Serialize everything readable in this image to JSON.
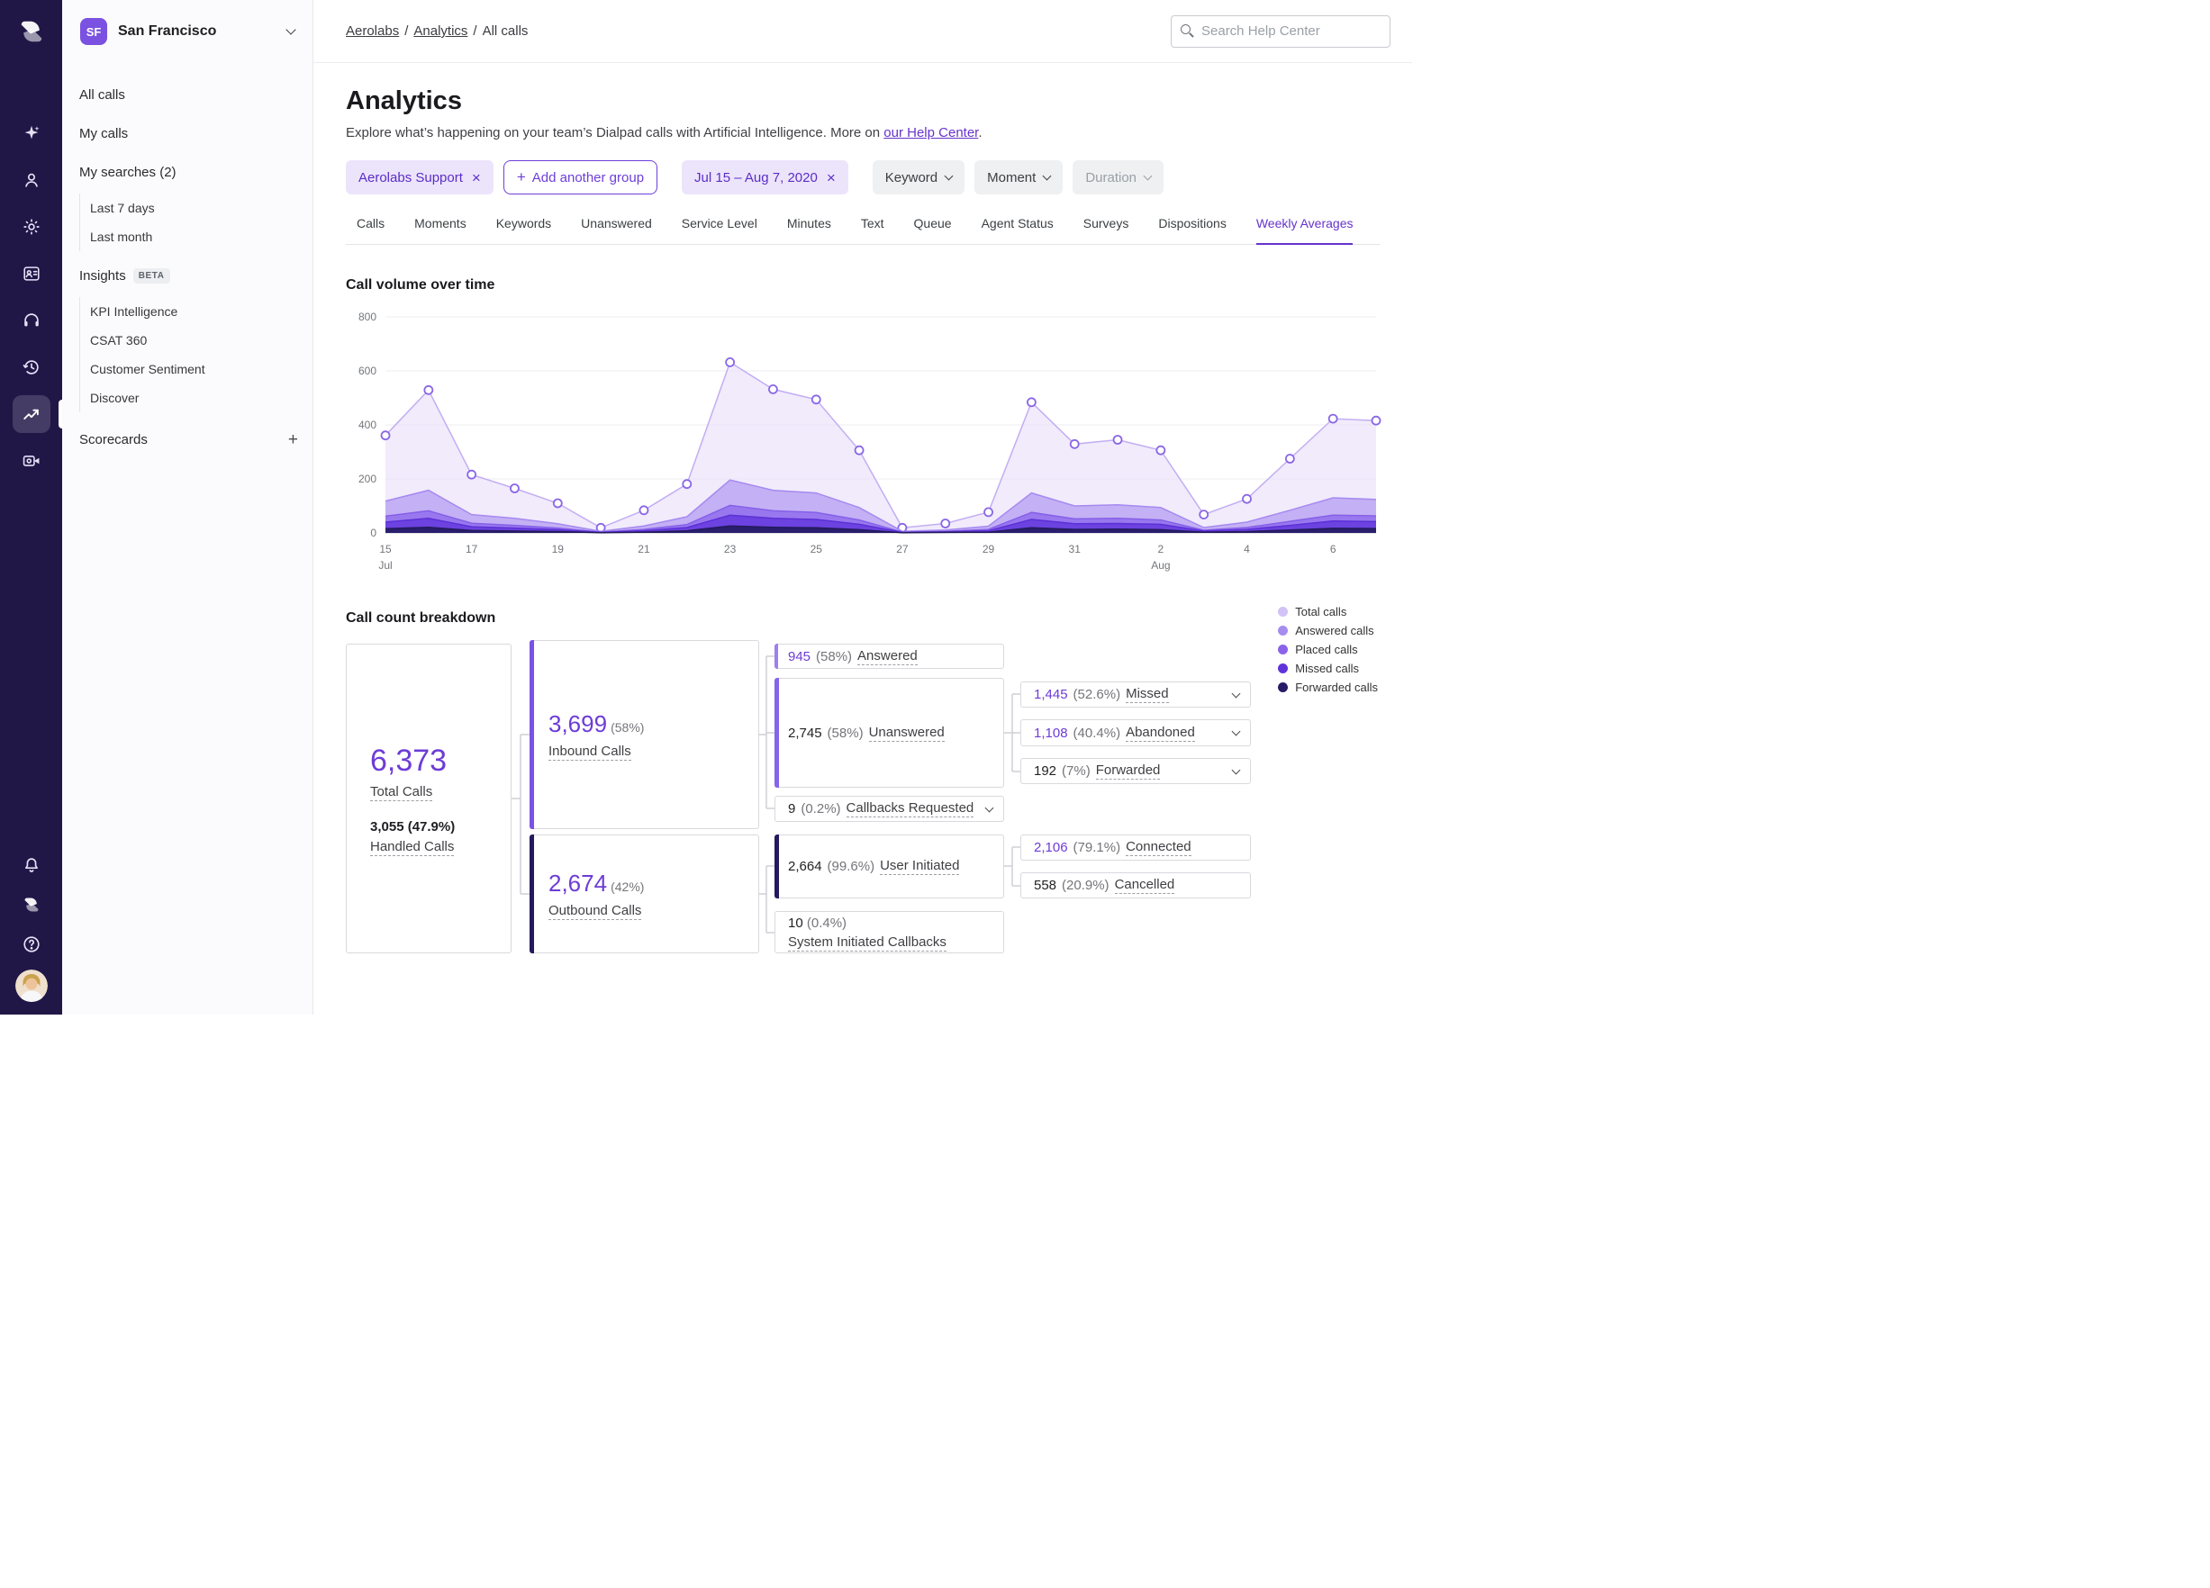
{
  "colors": {
    "accent": "#6633cc",
    "rail_bg": "#211747",
    "chip_purple_bg": "#ece4fb",
    "chip_purple_text": "#5b2ec7",
    "number_purple": "#6d3cd6"
  },
  "rail": {
    "top_icons": [
      "dialpad-logo",
      "ai-sparkle-icon",
      "person-icon",
      "gear-icon",
      "contacts-icon",
      "headset-icon",
      "history-icon",
      "analytics-trend-icon",
      "video-settings-icon"
    ],
    "bottom_icons": [
      "bell-icon",
      "dialpad-mark-icon",
      "help-icon",
      "user-avatar"
    ],
    "active_icon": "analytics-trend-icon"
  },
  "sidebar": {
    "workspace_initials": "SF",
    "workspace_name": "San Francisco",
    "all_calls": "All calls",
    "my_calls": "My calls",
    "my_searches": "My searches (2)",
    "searches": [
      "Last 7 days",
      "Last month"
    ],
    "insights": "Insights",
    "beta_badge": "BETA",
    "insights_items": [
      "KPI Intelligence",
      "CSAT 360",
      "Customer Sentiment",
      "Discover"
    ],
    "scorecards": "Scorecards",
    "add_scorecard": "+"
  },
  "topbar": {
    "breadcrumb": [
      "Aerolabs",
      "Analytics",
      "All calls"
    ],
    "separator": "/",
    "search_placeholder": "Search Help Center"
  },
  "page": {
    "title": "Analytics",
    "subtitle_pre": "Explore what’s happening on your team’s Dialpad calls with Artificial Intelligence. More on ",
    "subtitle_link": "our Help Center",
    "subtitle_post": "."
  },
  "filters": {
    "group": "Aerolabs Support",
    "remove": "×",
    "add_plus": "+",
    "add_group": "Add another group",
    "date_range": "Jul 15 – Aug 7, 2020",
    "keyword": "Keyword",
    "moment": "Moment",
    "duration": "Duration"
  },
  "tabs": {
    "items": [
      "Calls",
      "Moments",
      "Keywords",
      "Unanswered",
      "Service Level",
      "Minutes",
      "Text",
      "Queue",
      "Agent Status",
      "Surveys",
      "Dispositions",
      "Weekly Averages"
    ],
    "active": "Weekly Averages"
  },
  "chart_section": {
    "title": "Call volume over time"
  },
  "chart_data": {
    "type": "area",
    "title": "Call volume over time",
    "x": [
      "Jul 15",
      "Jul 16",
      "Jul 17",
      "Jul 18",
      "Jul 19",
      "Jul 20",
      "Jul 21",
      "Jul 22",
      "Jul 23",
      "Jul 24",
      "Jul 25",
      "Jul 26",
      "Jul 27",
      "Jul 28",
      "Jul 29",
      "Jul 30",
      "Jul 31",
      "Aug 1",
      "Aug 2",
      "Aug 3",
      "Aug 4",
      "Aug 5",
      "Aug 6",
      "Aug 7"
    ],
    "ylim": [
      0,
      800
    ],
    "yticks": [
      0,
      200,
      400,
      600,
      800
    ],
    "xticks": [
      {
        "i": 0,
        "label": "15",
        "sub": "Jul"
      },
      {
        "i": 2,
        "label": "17"
      },
      {
        "i": 4,
        "label": "19"
      },
      {
        "i": 6,
        "label": "21"
      },
      {
        "i": 8,
        "label": "23"
      },
      {
        "i": 10,
        "label": "25"
      },
      {
        "i": 12,
        "label": "27"
      },
      {
        "i": 14,
        "label": "29"
      },
      {
        "i": 16,
        "label": "31"
      },
      {
        "i": 18,
        "label": "2",
        "sub": "Aug"
      },
      {
        "i": 20,
        "label": "4"
      },
      {
        "i": 22,
        "label": "6"
      }
    ],
    "grid": true,
    "legend_position": "right-of-breakdown",
    "series": [
      {
        "name": "Total calls",
        "fill": "#e9e1fa",
        "fill_opacity": 0.65,
        "stroke": "#c3aef2",
        "markers": true,
        "values": [
          361,
          529,
          216,
          165,
          110,
          19,
          84,
          181,
          632,
          532,
          494,
          306,
          19,
          35,
          77,
          484,
          329,
          345,
          306,
          68,
          126,
          275,
          423,
          416
        ]
      },
      {
        "name": "Answered calls",
        "fill": "#b49cf1",
        "fill_opacity": 0.75,
        "stroke": "#a68af0",
        "markers": false,
        "values": [
          118,
          158,
          68,
          54,
          34,
          6,
          26,
          60,
          196,
          158,
          148,
          94,
          6,
          11,
          25,
          148,
          100,
          104,
          94,
          20,
          40,
          84,
          130,
          124
        ]
      },
      {
        "name": "Placed calls",
        "fill": "#8f6aee",
        "fill_opacity": 0.8,
        "stroke": "#855fe8",
        "markers": false,
        "values": [
          62,
          82,
          36,
          28,
          18,
          3,
          13,
          31,
          102,
          82,
          76,
          48,
          3,
          6,
          13,
          76,
          52,
          54,
          48,
          10,
          20,
          43,
          66,
          63
        ]
      },
      {
        "name": "Missed calls",
        "fill": "#6438dd",
        "fill_opacity": 0.85,
        "stroke": "#5c30d6",
        "markers": false,
        "values": [
          40,
          54,
          23,
          18,
          12,
          2,
          8,
          20,
          66,
          54,
          50,
          32,
          2,
          4,
          8,
          50,
          34,
          35,
          32,
          7,
          13,
          28,
          44,
          42
        ]
      },
      {
        "name": "Forwarded calls",
        "fill": "#271c67",
        "fill_opacity": 0.95,
        "stroke": "#231a5c",
        "markers": false,
        "values": [
          16,
          21,
          9,
          7,
          5,
          1,
          3,
          8,
          26,
          21,
          19,
          12,
          1,
          2,
          3,
          19,
          13,
          14,
          12,
          3,
          5,
          11,
          17,
          16
        ]
      }
    ]
  },
  "breakdown": {
    "title": "Call count breakdown",
    "legend": [
      {
        "label": "Total calls",
        "color": "#d2c2f6"
      },
      {
        "label": "Answered calls",
        "color": "#a78cf0"
      },
      {
        "label": "Placed calls",
        "color": "#8a63ea"
      },
      {
        "label": "Missed calls",
        "color": "#5f34da"
      },
      {
        "label": "Forwarded calls",
        "color": "#271c67"
      }
    ],
    "total": {
      "value": "6,373",
      "label": "Total Calls",
      "sub_value": "3,055 (47.9%)",
      "sub_label": "Handled Calls"
    },
    "inbound": {
      "value": "3,699",
      "pct": "(58%)",
      "label": "Inbound Calls"
    },
    "outbound": {
      "value": "2,674",
      "pct": "(42%)",
      "label": "Outbound Calls"
    },
    "answered": {
      "value": "945",
      "pct": "(58%)",
      "label": "Answered"
    },
    "unanswered": {
      "value": "2,745",
      "pct": "(58%)",
      "label": "Unanswered"
    },
    "callbacks": {
      "value": "9",
      "pct": "(0.2%)",
      "label": "Callbacks Requested"
    },
    "missed": {
      "value": "1,445",
      "pct": "(52.6%)",
      "label": "Missed"
    },
    "abandoned": {
      "value": "1,108",
      "pct": "(40.4%)",
      "label": "Abandoned"
    },
    "forwarded": {
      "value": "192",
      "pct": "(7%)",
      "label": "Forwarded"
    },
    "user_initiated": {
      "value": "2,664",
      "pct": "(99.6%)",
      "label": "User Initiated"
    },
    "connected": {
      "value": "2,106",
      "pct": "(79.1%)",
      "label": "Connected"
    },
    "cancelled": {
      "value": "558",
      "pct": "(20.9%)",
      "label": "Cancelled"
    },
    "system": {
      "value": "10",
      "pct": "(0.4%)",
      "label": "System Initiated Callbacks"
    }
  }
}
